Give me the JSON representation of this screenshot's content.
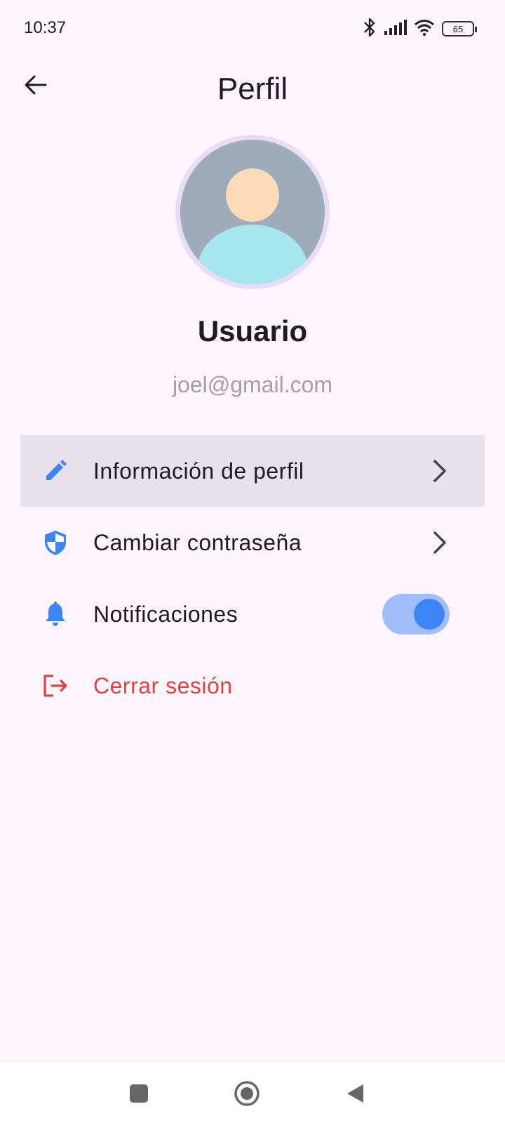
{
  "status_bar": {
    "time": "10:37",
    "battery": "65",
    "icons": [
      "bluetooth-icon",
      "signal-icon",
      "wifi-icon",
      "battery-icon"
    ]
  },
  "app_bar": {
    "title": "Perfil",
    "back_icon": "arrow-back-icon"
  },
  "profile": {
    "name": "Usuario",
    "email": "joel@gmail.com"
  },
  "menu": {
    "items": [
      {
        "label": "Información de perfil",
        "icon": "pencil-icon",
        "trailing": "chevron-right-icon",
        "selected": true
      },
      {
        "label": "Cambiar contraseña",
        "icon": "shield-icon",
        "trailing": "chevron-right-icon",
        "selected": false
      },
      {
        "label": "Notificaciones",
        "icon": "bell-icon",
        "trailing": "toggle",
        "toggle_on": true
      },
      {
        "label": "Cerrar sesión",
        "icon": "logout-icon",
        "danger": true
      }
    ]
  },
  "colors": {
    "background": "#fcf5fd",
    "accent": "#3d84f5",
    "toggle_track": "#a1bdfa",
    "danger": "#e0443e",
    "selected_row": "#e7e1e9",
    "email_text": "#a3a0a6"
  },
  "nav_bar": {
    "buttons": [
      "recents-icon",
      "home-icon",
      "back-triangle-icon"
    ]
  }
}
